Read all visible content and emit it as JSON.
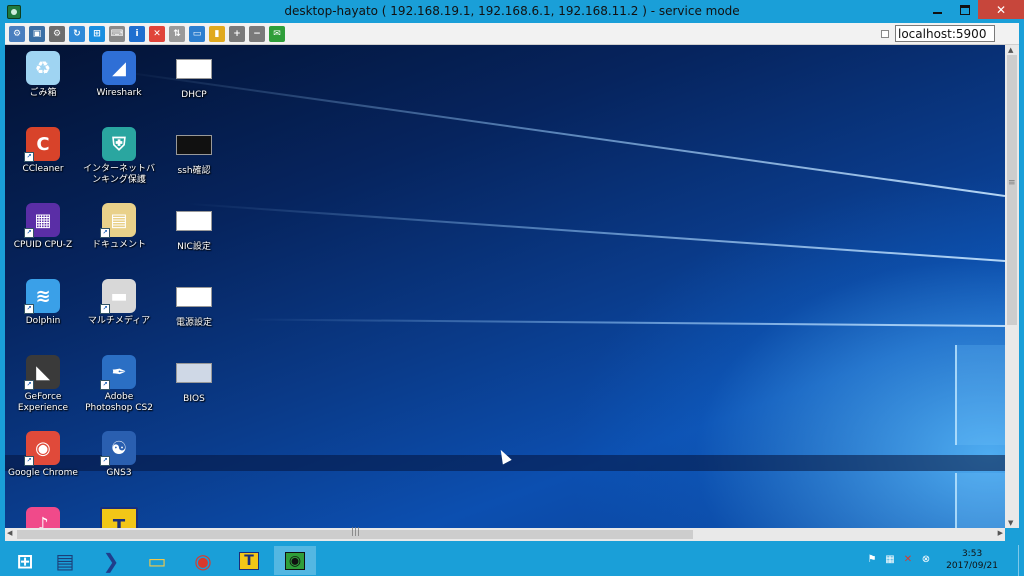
{
  "window": {
    "title": "desktop-hayato ( 192.168.19.1, 192.168.6.1, 192.168.11.2 ) - service mode",
    "min_glyph": "",
    "max_glyph": "",
    "close_glyph": "✕"
  },
  "toolbar": {
    "host_value": "localhost:5900",
    "tools": [
      {
        "name": "options-icon",
        "color": "#4a7fbf",
        "glyph": "⚙"
      },
      {
        "name": "fullscreen-icon",
        "color": "#3a6fa5",
        "glyph": "▣"
      },
      {
        "name": "settings-gear-icon",
        "color": "#6d6d6d",
        "glyph": "⚙"
      },
      {
        "name": "refresh-icon",
        "color": "#2f8ad8",
        "glyph": "↻"
      },
      {
        "name": "windows-key-icon",
        "color": "#1a8fe0",
        "glyph": "⊞"
      },
      {
        "name": "ctrl-alt-del-icon",
        "color": "#8a8a8a",
        "glyph": "⌨"
      },
      {
        "name": "info-icon",
        "color": "#1f6fd0",
        "glyph": "i"
      },
      {
        "name": "disconnect-icon",
        "color": "#e0443a",
        "glyph": "✕"
      },
      {
        "name": "file-transfer-icon",
        "color": "#9a9a9a",
        "glyph": "⇅"
      },
      {
        "name": "monitor-icon",
        "color": "#2d7fcf",
        "glyph": "▭"
      },
      {
        "name": "clipboard-icon",
        "color": "#e0a91e",
        "glyph": "▮"
      },
      {
        "name": "zoom-in-icon",
        "color": "#7a7a7a",
        "glyph": "+"
      },
      {
        "name": "zoom-out-icon",
        "color": "#7a7a7a",
        "glyph": "−"
      },
      {
        "name": "chat-icon",
        "color": "#2f9e3a",
        "glyph": "✉"
      }
    ]
  },
  "desktop": {
    "icons": [
      {
        "name": "recycle-bin",
        "label": "ごみ箱",
        "col": 0,
        "row": 0,
        "icon": "recycle-bin-icon",
        "color": "#9fd4f2",
        "shortcut": false
      },
      {
        "name": "wireshark",
        "label": "Wireshark",
        "col": 1,
        "row": 0,
        "icon": "wireshark-fin-icon",
        "color": "#2f6fd6",
        "shortcut": false
      },
      {
        "name": "dhcp",
        "label": "DHCP",
        "col": 2,
        "row": 0,
        "icon": "screenshot-thumbnail-icon",
        "color": "#ffffff",
        "shortcut": false
      },
      {
        "name": "ccleaner",
        "label": "CCleaner",
        "col": 0,
        "row": 1,
        "icon": "ccleaner-icon",
        "color": "#d8432a",
        "shortcut": true
      },
      {
        "name": "internet-banking",
        "label": "インターネットバンキング保護",
        "col": 1,
        "row": 1,
        "icon": "banking-shield-icon",
        "color": "#2aa6a0",
        "shortcut": false
      },
      {
        "name": "ssh-check",
        "label": "ssh確認",
        "col": 2,
        "row": 1,
        "icon": "terminal-thumbnail-icon",
        "color": "#111111",
        "shortcut": false
      },
      {
        "name": "cpuid-cpu-z",
        "label": "CPUID CPU-Z",
        "col": 0,
        "row": 2,
        "icon": "cpu-chip-icon",
        "color": "#5a2ea6",
        "shortcut": true
      },
      {
        "name": "documents",
        "label": "ドキュメント",
        "col": 1,
        "row": 2,
        "icon": "documents-folder-icon",
        "color": "#e9d18a",
        "shortcut": true
      },
      {
        "name": "nic-settings",
        "label": "NIC設定",
        "col": 2,
        "row": 2,
        "icon": "window-thumbnail-icon",
        "color": "#ffffff",
        "shortcut": false
      },
      {
        "name": "dolphin",
        "label": "Dolphin",
        "col": 0,
        "row": 3,
        "icon": "dolphin-icon",
        "color": "#3aa0e8",
        "shortcut": true
      },
      {
        "name": "multimedia",
        "label": "マルチメディア",
        "col": 1,
        "row": 3,
        "icon": "drive-icon",
        "color": "#d8d8d8",
        "shortcut": true
      },
      {
        "name": "power-settings",
        "label": "電源設定",
        "col": 2,
        "row": 3,
        "icon": "window-thumbnail-icon",
        "color": "#ffffff",
        "shortcut": false
      },
      {
        "name": "geforce-experience",
        "label": "GeForce Experience",
        "col": 0,
        "row": 4,
        "icon": "geforce-icon",
        "color": "#3a3a3a",
        "shortcut": true
      },
      {
        "name": "adobe-photoshop-cs2",
        "label": "Adobe Photoshop CS2",
        "col": 1,
        "row": 4,
        "icon": "photoshop-feather-icon",
        "color": "#2b6fc4",
        "shortcut": true
      },
      {
        "name": "bios",
        "label": "BIOS",
        "col": 2,
        "row": 4,
        "icon": "bios-thumbnail-icon",
        "color": "#cfd8e6",
        "shortcut": false
      },
      {
        "name": "google-chrome",
        "label": "Google Chrome",
        "col": 0,
        "row": 5,
        "icon": "chrome-icon",
        "color": "#e04a3a",
        "shortcut": true
      },
      {
        "name": "gns3",
        "label": "GNS3",
        "col": 1,
        "row": 5,
        "icon": "gns3-chameleon-icon",
        "color": "#2a5fb0",
        "shortcut": true
      },
      {
        "name": "itunes-partial",
        "label": "",
        "col": 0,
        "row": 6,
        "icon": "music-note-icon",
        "color": "#f04a8a",
        "shortcut": false
      },
      {
        "name": "tightvnc-partial",
        "label": "",
        "col": 1,
        "row": 6,
        "icon": "t-letter-icon",
        "color": "#f2c617",
        "shortcut": false
      }
    ]
  },
  "taskbar": {
    "items": [
      {
        "name": "start-button",
        "icon": "windows-logo-icon",
        "active": false
      },
      {
        "name": "taskbar-server-manager",
        "icon": "server-manager-icon",
        "active": false
      },
      {
        "name": "taskbar-powershell",
        "icon": "powershell-icon",
        "active": false
      },
      {
        "name": "taskbar-file-explorer",
        "icon": "folder-icon",
        "active": false
      },
      {
        "name": "taskbar-chrome",
        "icon": "chrome-icon",
        "active": false
      },
      {
        "name": "taskbar-tightvnc",
        "icon": "t-letter-icon",
        "active": false
      },
      {
        "name": "taskbar-vnc-viewer",
        "icon": "eye-icon",
        "active": true
      }
    ],
    "tray": [
      {
        "name": "flag-icon",
        "glyph": "⚑"
      },
      {
        "name": "network-icon",
        "glyph": "▦"
      },
      {
        "name": "volume-muted-icon",
        "glyph": "✕"
      },
      {
        "name": "security-alert-icon",
        "glyph": "⊗"
      }
    ],
    "time": "3:53",
    "date": "2017/09/21"
  }
}
